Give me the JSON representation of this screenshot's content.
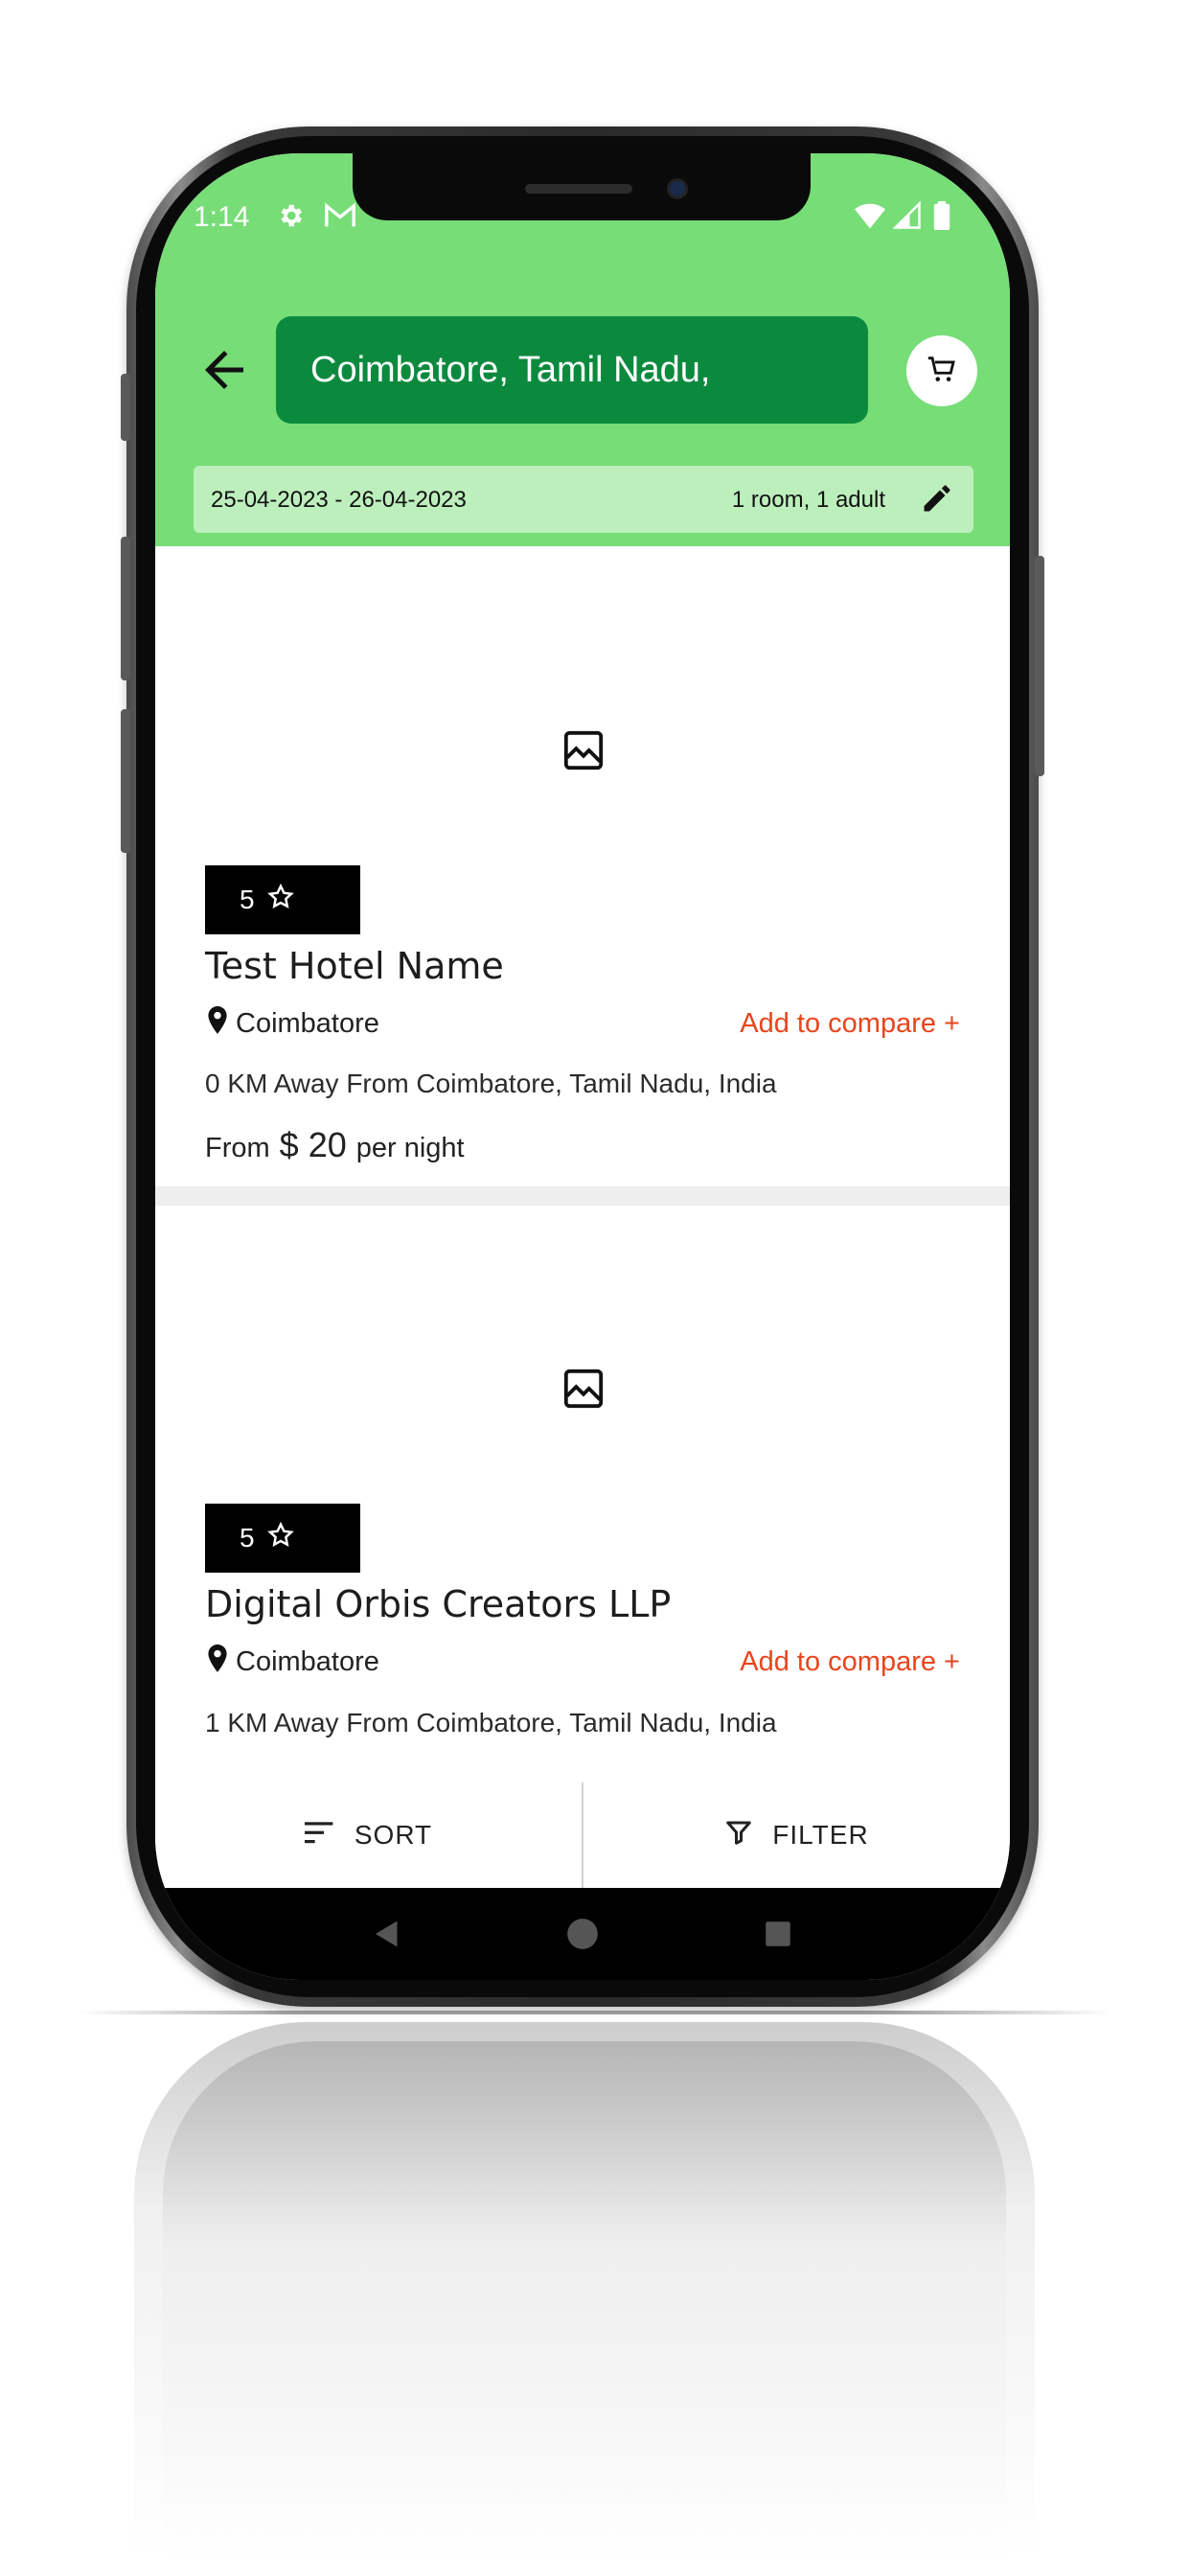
{
  "status_bar": {
    "time": "1:14",
    "icons": [
      "settings-icon",
      "gmail-icon",
      "wifi-icon",
      "signal-icon",
      "battery-icon"
    ]
  },
  "header": {
    "search_value": "Coimbatore, Tamil Nadu,",
    "date_range": "25-04-2023 - 26-04-2023",
    "guests": "1 room, 1 adult"
  },
  "hotels": [
    {
      "rating": "5",
      "name": "Test Hotel Name",
      "city": "Coimbatore",
      "compare_label": "Add to compare +",
      "distance": "0 KM Away From Coimbatore, Tamil Nadu, India",
      "price_from": "From",
      "currency": "$",
      "price": "20",
      "price_unit": "per night"
    },
    {
      "rating": "5",
      "name": "Digital Orbis Creators LLP",
      "city": "Coimbatore",
      "compare_label": "Add to compare +",
      "distance": "1 KM Away From Coimbatore, Tamil Nadu, India"
    }
  ],
  "actions": {
    "sort_label": "SORT",
    "filter_label": "FILTER"
  },
  "colors": {
    "header_green": "#77dd77",
    "search_green": "#0b8a3e",
    "date_bar_green": "#bdefbd",
    "compare_orange": "#e8451c"
  }
}
